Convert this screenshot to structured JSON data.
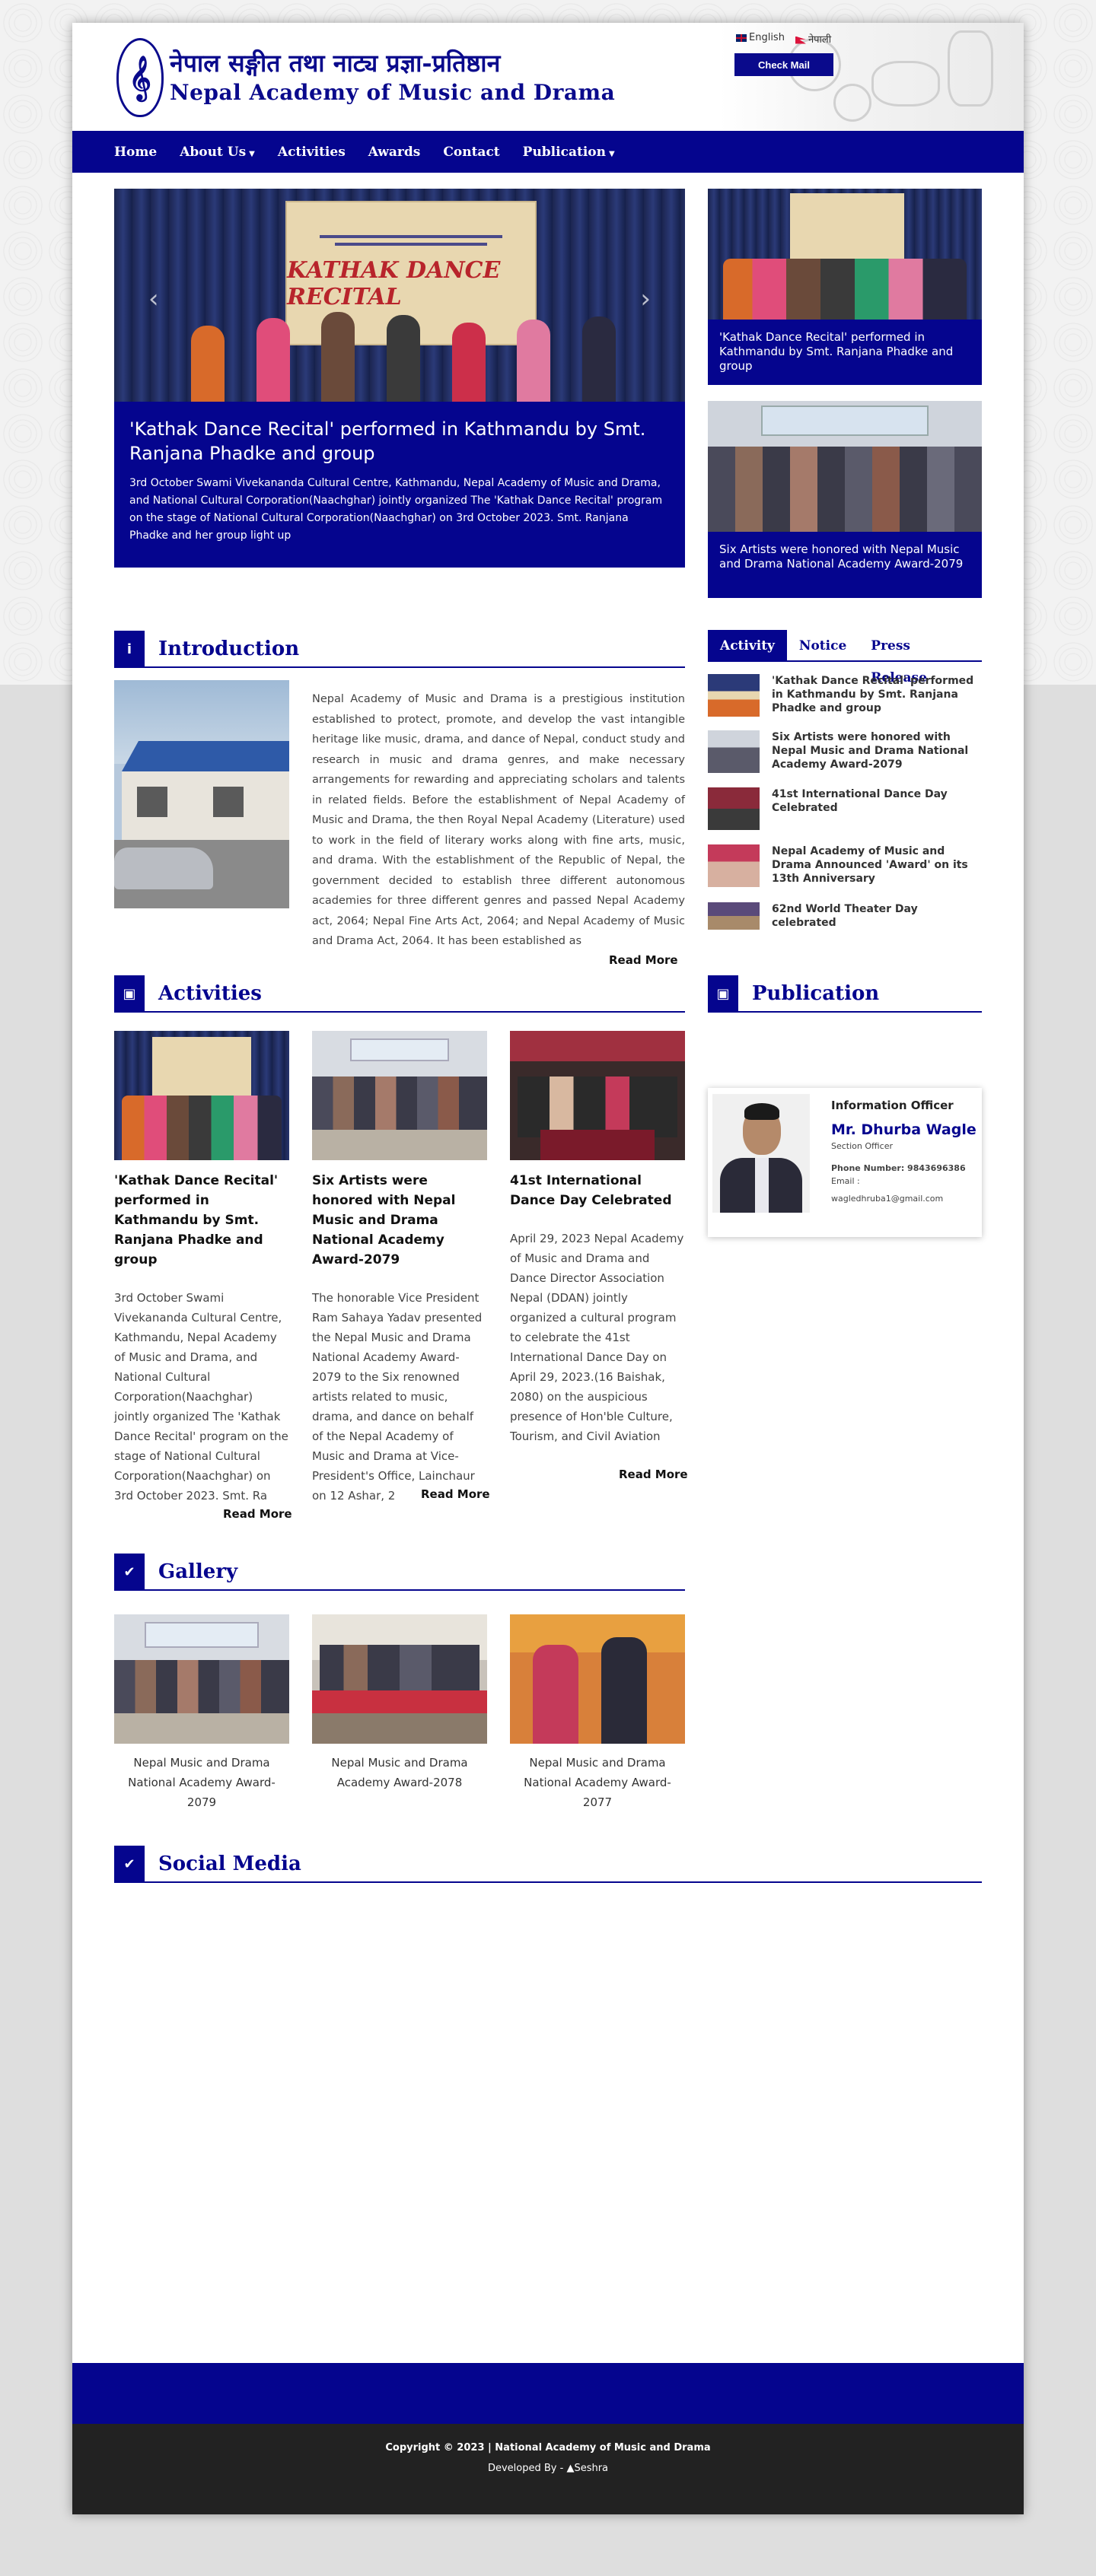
{
  "header": {
    "title_np": "नेपाल सङ्गीत तथा नाट्य प्रज्ञा-प्रतिष्ठान",
    "title_en": "Nepal Academy of  Music and Drama",
    "lang_en": "English",
    "lang_np": "नेपाली",
    "check_mail": "Check Mail"
  },
  "nav": {
    "home": "Home",
    "about": "About Us",
    "activities": "Activities",
    "awards": "Awards",
    "contact": "Contact",
    "publication": "Publication"
  },
  "hero": {
    "banner_title": "KATHAK DANCE RECITAL",
    "title": "'Kathak Dance Recital' performed in Kathmandu by Smt. Ranjana Phadke and group",
    "desc": "3rd October Swami Vivekananda Cultural Centre, Kathmandu, Nepal Academy of Music and Drama, and National Cultural Corporation(Naachghar) jointly organized The 'Kathak Dance Recital' program on the stage of National Cultural Corporation(Naachghar) on 3rd October 2023. Smt. Ranjana Phadke and her group light up"
  },
  "side_slides": [
    {
      "caption": "'Kathak Dance Recital' performed in Kathmandu by Smt. Ranjana Phadke and group"
    },
    {
      "caption": "Six Artists were honored with Nepal Music and Drama National Academy Award-2079"
    }
  ],
  "introduction": {
    "heading": "Introduction",
    "text": "Nepal Academy of Music and Drama is a prestigious institution established to protect, promote, and develop the vast intangible heritage like music, drama, and dance of Nepal, conduct study and research in music and drama genres, and make necessary arrangements for rewarding and appreciating scholars and talents in related fields. Before the establishment of Nepal Academy of Music and Drama, the then Royal Nepal Academy (Literature) used to work in the field of literary works along with fine arts, music, and drama. With the establishment of the Republic of Nepal, the government decided to establish three different autonomous academies for three different genres and passed Nepal Academy act, 2064; Nepal Fine Arts Act, 2064; and Nepal Academy of Music and Drama Act, 2064.  It has been established as",
    "read_more": "Read More"
  },
  "tabs": {
    "activity": "Activity",
    "notice": "Notice",
    "press": "Press Release"
  },
  "news": [
    {
      "title": "'Kathak Dance Recital' performed in Kathmandu by Smt. Ranjana Phadke and group"
    },
    {
      "title": "Six Artists were honored with Nepal Music and Drama National Academy Award-2079"
    },
    {
      "title": "41st International Dance Day Celebrated"
    },
    {
      "title": "Nepal Academy of Music and Drama Announced 'Award' on its 13th Anniversary"
    },
    {
      "title": "62nd World Theater Day celebrated"
    }
  ],
  "activities": {
    "heading": "Activities",
    "items": [
      {
        "title": "'Kathak Dance Recital' performed in Kathmandu by Smt. Ranjana Phadke and group",
        "desc": "3rd October Swami Vivekananda Cultural Centre, Kathmandu, Nepal Academy of Music and Drama, and National Cultural Corporation(Naachghar) jointly organized The 'Kathak Dance Recital' program on the stage of National Cultural Corporation(Naachghar) on 3rd October 2023.  Smt. Ra",
        "read_more": "Read More"
      },
      {
        "title": "Six Artists were honored with Nepal Music and Drama National Academy Award-2079",
        "desc": "The honorable Vice President Ram Sahaya Yadav presented the Nepal Music and Drama National Academy Award-2079 to the Six renowned artists related to music, drama, and dance on behalf of the Nepal Academy of Music and Drama at  Vice-President's Office, Lainchaur on 12 Ashar, 2",
        "read_more": "Read More"
      },
      {
        "title": "41st International Dance Day Celebrated",
        "desc": "April 29, 2023 Nepal Academy of Music and Drama and Dance Director Association Nepal (DDAN) jointly organized a cultural program to celebrate the 41st International Dance Day on April 29, 2023.(16 Baishak, 2080) on the auspicious presence of Hon'ble Culture, Tourism, and Civil Aviation",
        "read_more": "Read More"
      }
    ]
  },
  "publication": {
    "heading": "Publication"
  },
  "officer": {
    "label": "Information Officer",
    "name": "Mr. Dhurba Wagle",
    "role": "Section Officer",
    "phone": "Phone Number: 9843696386",
    "email_label": "Email :",
    "email": "wagledhruba1@gmail.com"
  },
  "gallery": {
    "heading": "Gallery",
    "items": [
      {
        "caption": "Nepal Music and Drama National Academy Award-2079"
      },
      {
        "caption": "Nepal Music and Drama Academy Award-2078"
      },
      {
        "caption": "Nepal Music and Drama National Academy Award-2077"
      }
    ]
  },
  "social": {
    "heading": "Social Media"
  },
  "footer": {
    "copyright": "Copyright © 2023 | National Academy of Music and Drama",
    "developed": "Developed By - ",
    "developer": "Seshra"
  },
  "colors": {
    "primary": "#05058e",
    "footer_dark": "#222222"
  }
}
